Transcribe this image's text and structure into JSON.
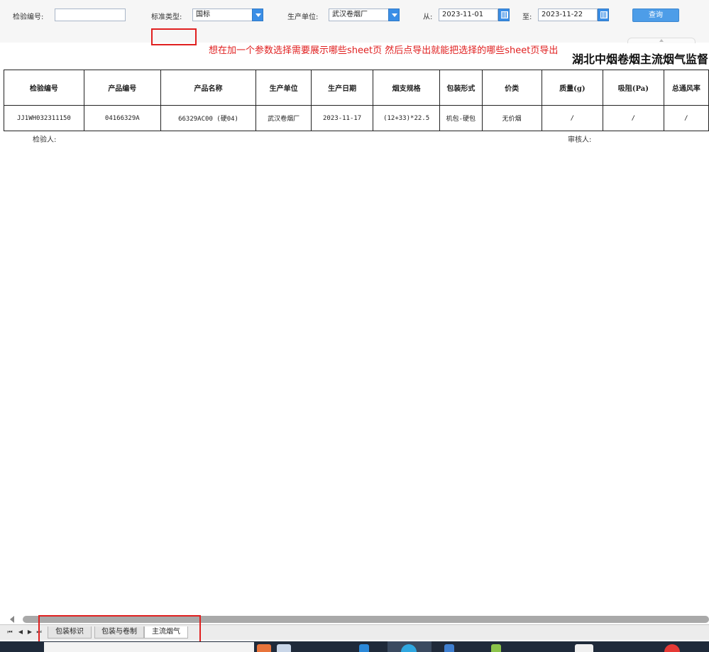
{
  "query": {
    "inspection_no_label": "检验编号:",
    "inspection_no_value": "",
    "standard_type_label": "标准类型:",
    "standard_type_value": "国标",
    "producer_label": "生产单位:",
    "producer_value": "武汉卷烟厂",
    "from_label": "从:",
    "from_value": "2023-11-01",
    "to_label": "至:",
    "to_value": "2023-11-22",
    "query_button": "查询"
  },
  "annotation": {
    "note": "想在加一个参数选择需要展示哪些sheet页 然后点导出就能把选择的哪些sheet页导出",
    "color": "#e02020"
  },
  "report": {
    "title": "湖北中烟卷烟主流烟气监督",
    "columns": [
      "检验编号",
      "产品编号",
      "产品名称",
      "生产单位",
      "生产日期",
      "烟支规格",
      "包装形式",
      "价类",
      "质量(g)",
      "吸阻(Pa)",
      "总通风率"
    ],
    "rows": [
      [
        "JJ1WH032311150",
        "04166329A",
        "66329AC00 (硬04)",
        "武汉卷烟厂",
        "2023-11-17",
        "(12+33)*22.5",
        "机包-硬包",
        "无价烟",
        "/",
        "/",
        "/"
      ]
    ],
    "inspector_label": "检验人:",
    "reviewer_label": "审核人:"
  },
  "sheets": {
    "tabs": [
      "包装标识",
      "包装与卷制",
      "主流烟气"
    ],
    "active": "主流烟气"
  },
  "colors": {
    "accent": "#3a8ee6",
    "query_button": "#4d9de8",
    "taskbar": "#1f2a3a"
  }
}
